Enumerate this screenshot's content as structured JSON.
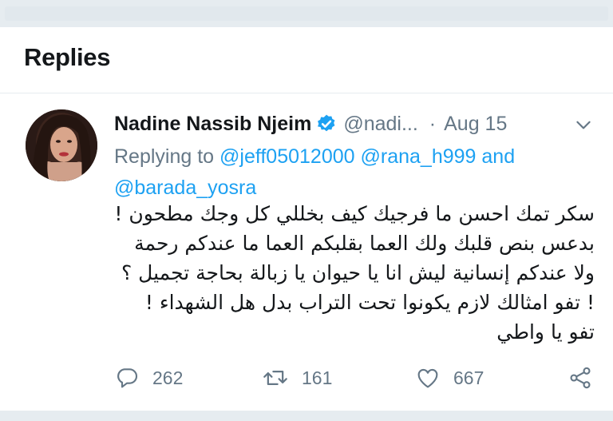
{
  "header": {
    "title": "Replies"
  },
  "tweet": {
    "author": {
      "name": "Nadine Nassib Njeim",
      "handle": "@nadi...",
      "verified": true
    },
    "separator": "·",
    "date": "Aug 15",
    "replying_prefix": "Replying to",
    "mentions": [
      "@jeff05012000",
      "@rana_h999"
    ],
    "mentions_joiner": "and",
    "mention_last": "@barada_yosra",
    "text": "سكر تمك احسن ما فرجيك كيف بخللي كل وجك مطحون ! بدعس بنص قلبك ولك العما بقلبكم العما ما عندكم رحمة ولا عندكم إنسانية ليش انا يا حيوان يا زبالة بحاجة تجميل ؟ ! تفو امثالك لازم يكونوا تحت التراب بدل هل الشهداء ! تفو يا واطي",
    "actions": {
      "reply_count": "262",
      "retweet_count": "161",
      "like_count": "667"
    }
  },
  "icons": {
    "verified": "verified-badge-icon",
    "caret": "chevron-down-icon",
    "reply": "reply-bubble-icon",
    "retweet": "retweet-icon",
    "like": "heart-icon",
    "share": "share-icon"
  },
  "colors": {
    "accent": "#1da1f2",
    "muted": "#657786",
    "text": "#14171a",
    "divider": "#e6ecf0"
  }
}
